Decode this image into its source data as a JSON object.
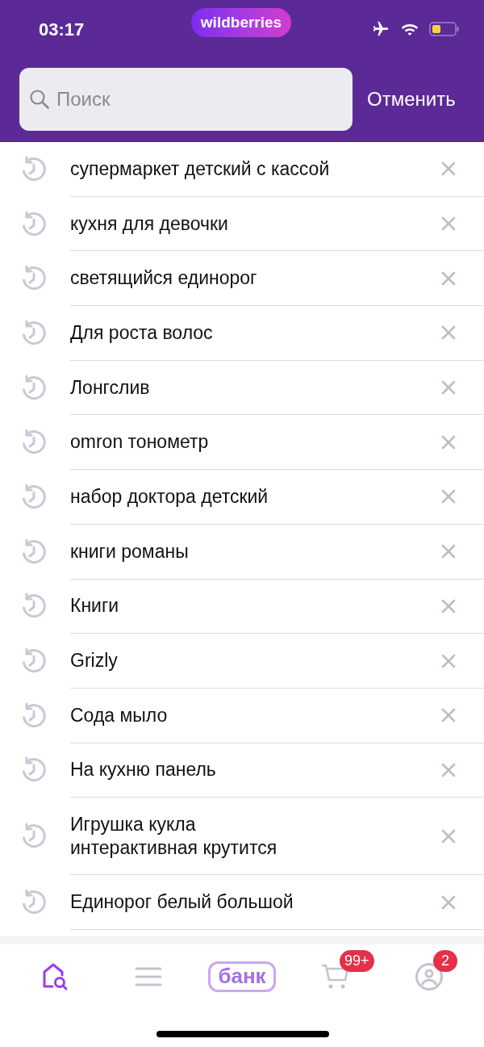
{
  "status_bar": {
    "time": "03:17",
    "brand": "wildberries"
  },
  "search": {
    "placeholder": "Поиск",
    "cancel": "Отменить"
  },
  "history": [
    {
      "text": "супермаркет детский с кассой"
    },
    {
      "text": "кухня для девочки"
    },
    {
      "text": "светящийся единорог"
    },
    {
      "text": "Для роста волос"
    },
    {
      "text": "Лонгслив"
    },
    {
      "text": "omron тонометр"
    },
    {
      "text": "набор доктора детский"
    },
    {
      "text": "книги романы"
    },
    {
      "text": "Книги"
    },
    {
      "text": "Grizly"
    },
    {
      "text": "Сода мыло"
    },
    {
      "text": "На кухню панель"
    },
    {
      "text": "Игрушка кукла\nинтерактивная крутится"
    },
    {
      "text": "Единорог белый большой"
    }
  ],
  "nav": [
    {
      "kind": "home",
      "selected": true
    },
    {
      "kind": "catalog",
      "selected": false
    },
    {
      "kind": "bank",
      "selected": false,
      "label": "банк"
    },
    {
      "kind": "cart",
      "selected": false,
      "badge": "99+"
    },
    {
      "kind": "profile",
      "selected": false,
      "badge": "2"
    }
  ]
}
